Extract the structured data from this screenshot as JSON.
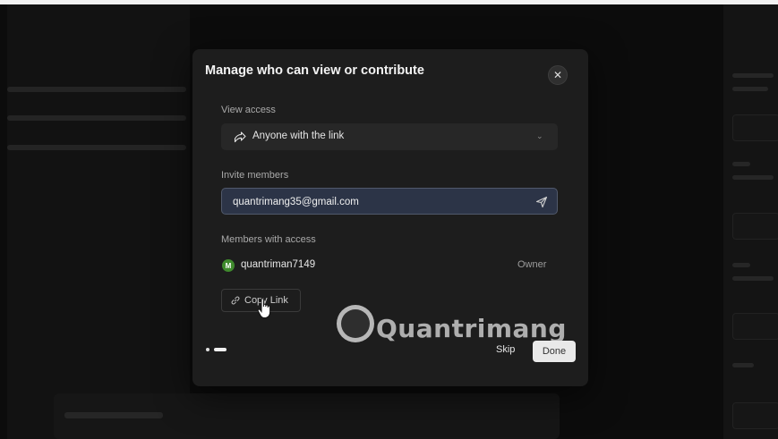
{
  "modal": {
    "title": "Manage who can view or contribute",
    "close_icon": "close-icon"
  },
  "view_access": {
    "label": "View access",
    "selected": "Anyone with the link",
    "icon": "share-arrow-icon"
  },
  "invite": {
    "label": "Invite members",
    "value": "quantrimang35@gmail.com",
    "send_icon": "send-icon"
  },
  "members": {
    "label": "Members with access",
    "items": [
      {
        "initial": "M",
        "name": "quantriman7149",
        "role": "Owner",
        "avatar_color": "#3f8a2d"
      }
    ]
  },
  "copy_link": {
    "label": "Copy Link",
    "icon": "link-icon"
  },
  "footer": {
    "pagination_step": 2,
    "pagination_total": 2,
    "skip_label": "Skip",
    "done_label": "Done"
  },
  "watermark": {
    "text": "Quantrimang"
  },
  "colors": {
    "modal_bg": "#1d1d1d",
    "input_focus_bg": "#2c3447",
    "done_bg": "#e9e9e9"
  }
}
